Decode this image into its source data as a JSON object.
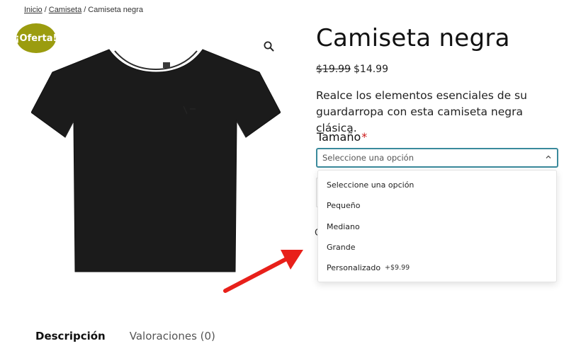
{
  "breadcrumb": {
    "items": [
      "Inicio",
      "Camiseta",
      "Camiseta negra"
    ],
    "separator": "/"
  },
  "sale_badge": {
    "label": "¡Oferta!",
    "color": "#9b9c0f"
  },
  "icons": {
    "zoom": "magnifier-icon",
    "select_chevron": "chevron-up-icon"
  },
  "product": {
    "title": "Camiseta negra",
    "old_price": "$19.99",
    "price": "$14.99",
    "description": "Realce los elementos esenciales de su guardarropa con esta camiseta negra clásica."
  },
  "variation": {
    "label": "Tamaño",
    "required_mark": "*",
    "selected": "Seleccione una opción",
    "options": [
      {
        "label": "Seleccione una opción",
        "extra": ""
      },
      {
        "label": "Pequeño",
        "extra": ""
      },
      {
        "label": "Mediano",
        "extra": ""
      },
      {
        "label": "Grande",
        "extra": ""
      },
      {
        "label": "Personalizado",
        "extra": "+$9.99"
      }
    ],
    "accent_color": "#3a8a9c"
  },
  "partially_hidden": {
    "char": "C"
  },
  "annotation": {
    "arrow_color": "#e8201a"
  },
  "tabs": [
    {
      "label": "Descripción",
      "active": true
    },
    {
      "label": "Valoraciones (0)",
      "active": false
    }
  ]
}
